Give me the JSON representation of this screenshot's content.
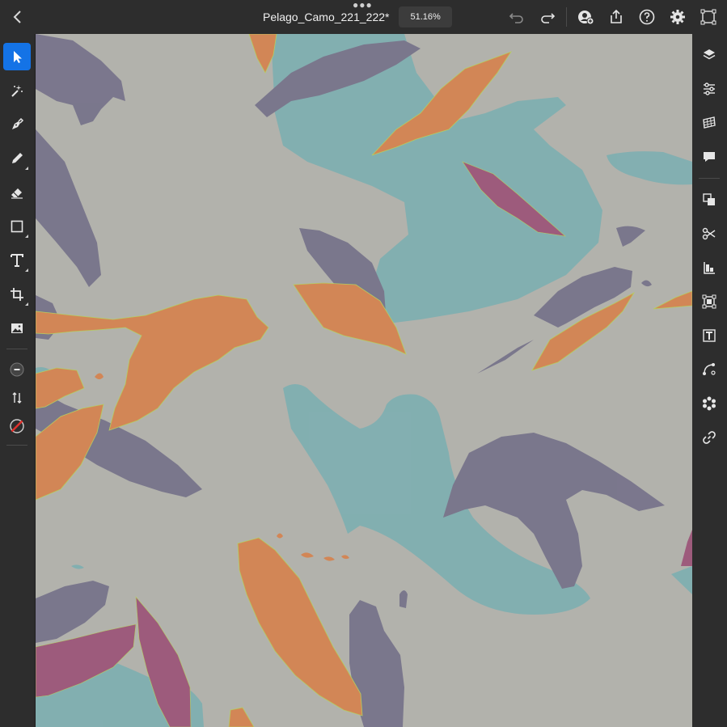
{
  "app": {
    "document_title": "Pelago_Camo_221_222*",
    "zoom_level": "51.16%"
  },
  "colors": {
    "chrome": "#2d2d2d",
    "accent": "#1473e6",
    "canvas_bg": "#b2b2ac",
    "teal": "#7fafb1",
    "purple": "#76728a",
    "orange": "#d5834f",
    "magenta": "#9c5479"
  },
  "top_actions": [
    "undo-icon",
    "redo-icon",
    "invite-user-icon",
    "share-icon",
    "help-icon",
    "settings-icon",
    "transform-icon"
  ],
  "left_tools": [
    "selection-arrow-icon",
    "direct-selection-icon",
    "pen-icon",
    "pencil-icon",
    "eraser-icon",
    "rectangle-icon",
    "type-icon",
    "crop-icon",
    "image-icon",
    "fill-stroke-icon",
    "swap-icon",
    "no-color-icon"
  ],
  "right_panels": [
    "layers-icon",
    "properties-icon",
    "grid-icon",
    "comments-icon",
    "arrange-icon",
    "scissors-icon",
    "align-icon",
    "transform-box-icon",
    "text-panel-icon",
    "path-icon",
    "repeat-icon",
    "link-icon"
  ]
}
